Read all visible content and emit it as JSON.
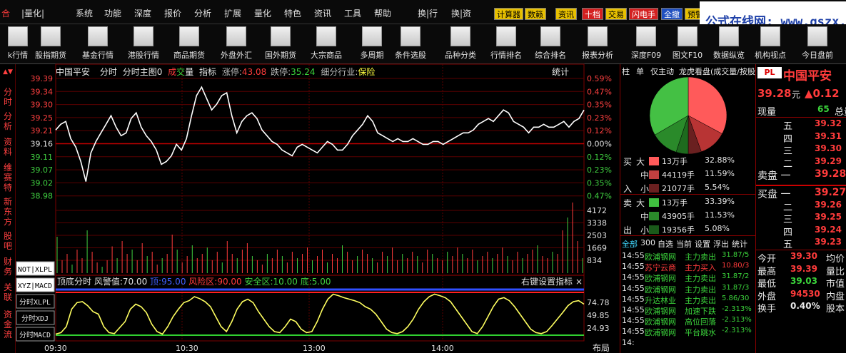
{
  "menubar": {
    "left_items": [
      "合",
      "|量化|"
    ],
    "items": [
      "系统",
      "功能",
      "深度",
      "报价",
      "分析",
      "扩展",
      "量化",
      "特色",
      "资讯",
      "工具",
      "帮助"
    ],
    "trade_items": [
      "换|行",
      "换|资"
    ],
    "right_buttons": [
      {
        "label": "计算器",
        "bg": "#e8c000",
        "fg": "#000"
      },
      {
        "label": "数籁",
        "bg": "#e8c000",
        "fg": "#000"
      },
      {
        "label": "资讯",
        "bg": "#e8c000",
        "fg": "#000"
      },
      {
        "label": "十档",
        "bg": "#d42020",
        "fg": "#fff"
      },
      {
        "label": "交易",
        "bg": "#e8c000",
        "fg": "#000"
      },
      {
        "label": "闪电手",
        "bg": "#d42020",
        "fg": "#fff"
      },
      {
        "label": "全撤",
        "bg": "#2050c0",
        "fg": "#fff"
      },
      {
        "label": "预警",
        "bg": "#e8c000",
        "fg": "#000"
      }
    ],
    "ad_text": "公式在线网: www.gszx.com.cn"
  },
  "toolbar": {
    "tools": [
      "k行情",
      "股指期货",
      "基金行情",
      "港股行情",
      "商品期货",
      "外盘外汇",
      "国外期货",
      "大宗商品",
      "多周期",
      "条件选股",
      "品种分类",
      "行情排名",
      "综合排名",
      "报表分析",
      "深度F09",
      "图文F10",
      "数据纵览",
      "机构视点",
      "今日盘前"
    ]
  },
  "left_tabs": [
    "分时",
    "分析",
    "资料",
    "维赛特",
    "新东方",
    "股吧",
    "财务",
    "关联",
    "资金流"
  ],
  "header": {
    "stock_name": "中国平安",
    "mode": "分时",
    "main_chart": "分时主图0",
    "cheng": "成",
    "jiao": "交",
    "liang": "量",
    "indicator": "指标",
    "limit_up_label": "涨停:",
    "limit_up": "43.08",
    "limit_down_label": "跌停:",
    "limit_down": "35.24",
    "industry_label": "细分行业:",
    "industry": "保险",
    "stats": "统计"
  },
  "price_axis": {
    "left": [
      "39.39",
      "39.34",
      "39.30",
      "39.25",
      "39.21",
      "39.16",
      "39.11",
      "39.07",
      "39.02",
      "38.98"
    ],
    "right": [
      "0.59%",
      "0.47%",
      "0.35%",
      "0.23%",
      "0.12%",
      "0.00%",
      "0.12%",
      "0.23%",
      "0.35%",
      "0.47%"
    ]
  },
  "volume_axis": [
    "4172",
    "3338",
    "2503",
    "1669",
    "834"
  ],
  "indicator_panel": {
    "title": "顶底分时",
    "warn_label": "风警值:",
    "warn_value": "70.00",
    "top_label": "顶:",
    "top_value": "95.00",
    "risk_label": "风险区:",
    "risk_value": "90.00",
    "safe_label": "安全区:",
    "safe_value": "10.00",
    "bottom_label": "底:",
    "bottom_value": "5.00",
    "settings": "右键设置指标",
    "close": "×",
    "axis": [
      "74.78",
      "49.85",
      "24.93"
    ]
  },
  "indicator_buttons": [
    "NOT|XLPL",
    "XYZ|MACD",
    "分时XLPL",
    "分时XDJ",
    "分时MACD"
  ],
  "time_axis": [
    "09:30",
    "10:30",
    "13:00",
    "14:00"
  ],
  "layout_button": "布局",
  "chart_data": {
    "type": "line",
    "series": [
      {
        "values": [
          39.21,
          39.23,
          39.24,
          39.18,
          39.15,
          39.1,
          39.03,
          39.13,
          39.17,
          39.2,
          39.23,
          39.26,
          39.22,
          39.19,
          39.2,
          39.25,
          39.27,
          39.22,
          39.19,
          39.17,
          39.14,
          39.09,
          39.1,
          39.12,
          39.16,
          39.14,
          39.18,
          39.26,
          39.33,
          39.36,
          39.32,
          39.28,
          39.3,
          39.33,
          39.34,
          39.26,
          39.2,
          39.24,
          39.26,
          39.27,
          39.25,
          39.21,
          39.19,
          39.17,
          39.16,
          39.14,
          39.13,
          39.12,
          39.15,
          39.16,
          39.15,
          39.14,
          39.13,
          39.15,
          39.17,
          39.16,
          39.14,
          39.14,
          39.16,
          39.19,
          39.21,
          39.23,
          39.26,
          39.24,
          39.2,
          39.19,
          39.18,
          39.17,
          39.18,
          39.17,
          39.17,
          39.18,
          39.17,
          39.16,
          39.16,
          39.17,
          39.17,
          39.16,
          39.17,
          39.18,
          39.19,
          39.2,
          39.2,
          39.21,
          39.23,
          39.24,
          39.25,
          39.24,
          39.26,
          39.28,
          39.27,
          39.24,
          39.23,
          39.22,
          39.2,
          39.22,
          39.22,
          39.23,
          39.22,
          39.22,
          39.23,
          39.24,
          39.22,
          39.24,
          39.25,
          39.28
        ]
      },
      {
        "values": [
          34,
          12,
          18,
          8,
          22,
          14,
          40,
          20,
          10,
          6,
          12,
          25,
          14,
          30,
          18,
          22,
          12,
          28,
          16,
          20,
          8,
          14,
          18,
          36,
          22,
          10,
          16,
          26,
          14,
          18,
          24,
          12,
          20,
          10,
          30,
          18,
          14,
          22,
          28,
          16,
          12,
          8,
          18,
          14,
          22,
          16,
          10,
          20,
          14,
          18,
          24,
          12,
          16,
          22,
          10,
          18,
          14,
          26,
          20,
          12,
          16,
          22,
          18,
          14,
          10,
          20,
          16,
          24,
          12,
          18,
          14,
          20,
          16,
          10,
          22,
          18,
          14,
          12,
          20,
          16,
          24,
          18,
          14,
          22,
          12,
          16,
          20,
          14,
          18,
          24,
          16,
          12,
          20,
          14,
          18,
          22,
          26,
          16,
          14,
          20,
          18,
          40,
          52,
          66,
          30,
          14
        ]
      },
      {
        "values": [
          5,
          8,
          20,
          55,
          68,
          70,
          62,
          50,
          45,
          20,
          8,
          6,
          18,
          30,
          55,
          65,
          60,
          48,
          25,
          10,
          5,
          20,
          40,
          55,
          68,
          72,
          80,
          76,
          70,
          60,
          40,
          20,
          10,
          30,
          55,
          70,
          75,
          68,
          50,
          35,
          20,
          10,
          8,
          20,
          35,
          30,
          15,
          8,
          10,
          30,
          55,
          75,
          85,
          82,
          78,
          75,
          72,
          68,
          60,
          55,
          45,
          30,
          15,
          8,
          6,
          10,
          20,
          35,
          55,
          70,
          80,
          85,
          82,
          78,
          70,
          55,
          40,
          25,
          10,
          6,
          20,
          40,
          60,
          75,
          78,
          72,
          60,
          45,
          30,
          15,
          8,
          6,
          10,
          22,
          35,
          48,
          62,
          70,
          72,
          65
        ]
      }
    ]
  },
  "mid_panel": {
    "tabs": [
      "柱",
      "单",
      "仅主动",
      "龙虎看盘(成交量/按股"
    ],
    "buy_rows": [
      {
        "side": "买",
        "size": "大",
        "color": "#ff5a5a",
        "vol": "13万手",
        "pct": "32.88%"
      },
      {
        "side": "",
        "size": "中",
        "color": "#c04040",
        "vol": "44119手",
        "pct": "11.59%"
      },
      {
        "side": "入",
        "size": "小",
        "color": "#6a2020",
        "vol": "21077手",
        "pct": "5.54%"
      }
    ],
    "sell_rows": [
      {
        "side": "卖",
        "size": "大",
        "color": "#40c040",
        "vol": "13万手",
        "pct": "33.39%"
      },
      {
        "side": "",
        "size": "中",
        "color": "#2a8a2a",
        "vol": "43905手",
        "pct": "11.53%"
      },
      {
        "side": "出",
        "size": "小",
        "color": "#1a5a1a",
        "vol": "19356手",
        "pct": "5.08%"
      }
    ],
    "pie": [
      32.88,
      11.59,
      5.54,
      5.08,
      11.53,
      33.39
    ],
    "filter_tabs": [
      "全部",
      "300",
      "自选",
      "当前",
      "设置",
      "浮出",
      "统计"
    ],
    "ticks": [
      {
        "time": "14:55",
        "name": "欧浦钢网",
        "event": "主力卖出",
        "value": "31.87/5",
        "cls": "green"
      },
      {
        "time": "14:55",
        "name": "苏宁云商",
        "event": "主力买入",
        "value": "10.80/3",
        "cls": "red"
      },
      {
        "time": "14:55",
        "name": "欧浦钢网",
        "event": "主力卖出",
        "value": "31.87/2",
        "cls": "green"
      },
      {
        "time": "14:55",
        "name": "欧浦钢网",
        "event": "主力卖出",
        "value": "31.87/3",
        "cls": "green"
      },
      {
        "time": "14:55",
        "name": "升达林业",
        "event": "主力卖出",
        "value": "5.86/30",
        "cls": "green"
      },
      {
        "time": "14:55",
        "name": "欧浦钢网",
        "event": "加速下跌",
        "value": "-2.313%",
        "cls": "green"
      },
      {
        "time": "14:55",
        "name": "欧浦钢网",
        "event": "高位回落",
        "value": "-2.313%",
        "cls": "green"
      },
      {
        "time": "14:55",
        "name": "欧浦钢网",
        "event": "平台跳水",
        "value": "-2.313%",
        "cls": "green"
      },
      {
        "time": "14:",
        "name": "",
        "event": "",
        "value": "",
        "cls": "green"
      }
    ]
  },
  "right_panel": {
    "logo": "PL",
    "name": "中国平安",
    "price": "39.28",
    "unit": "元",
    "change": "▲0.12",
    "current_vol_label": "现量",
    "current_vol": "65",
    "total_label": "总量",
    "asks": [
      {
        "label": "五",
        "price": "39.32"
      },
      {
        "label": "四",
        "price": "39.31"
      },
      {
        "label": "三",
        "price": "39.30"
      },
      {
        "label": "二",
        "price": "39.29"
      },
      {
        "label": "卖盘 一",
        "price": "39.28"
      }
    ],
    "bids": [
      {
        "label": "买盘 一",
        "price": "39.27"
      },
      {
        "label": "二",
        "price": "39.26"
      },
      {
        "label": "三",
        "price": "39.25"
      },
      {
        "label": "四",
        "price": "39.24"
      },
      {
        "label": "五",
        "price": "39.23"
      }
    ],
    "stats": [
      {
        "label": "今开",
        "value": "39.30",
        "cls": "red",
        "tail": "均价"
      },
      {
        "label": "最高",
        "value": "39.39",
        "cls": "red",
        "tail": "量比"
      },
      {
        "label": "最低",
        "value": "39.03",
        "cls": "green",
        "tail": "市值"
      },
      {
        "label": "外盘",
        "value": "94530",
        "cls": "red",
        "tail": "内盘"
      },
      {
        "label": "换手",
        "value": "0.40%",
        "cls": "white",
        "tail": "股本"
      }
    ]
  }
}
